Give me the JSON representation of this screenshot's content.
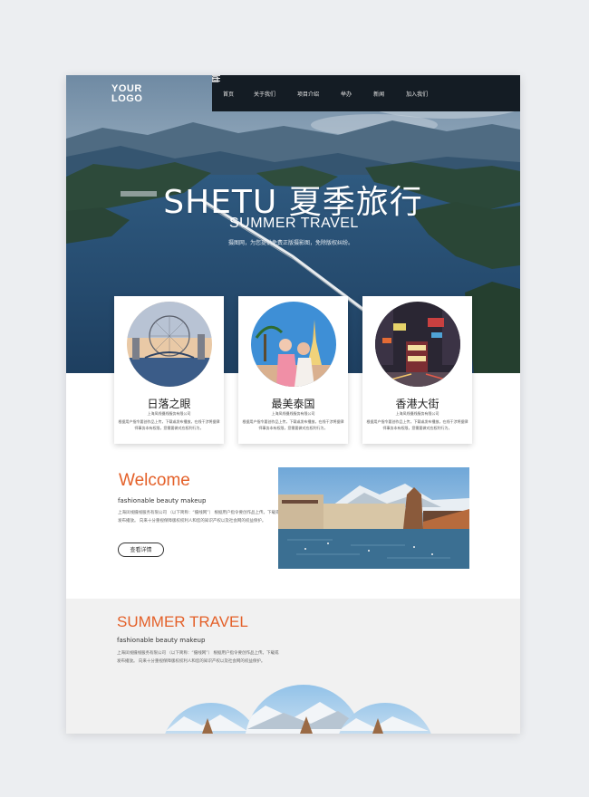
{
  "logo": {
    "line1": "YOUR",
    "line2": "LOGO"
  },
  "nav": {
    "items": [
      "首页",
      "关于我们",
      "项目介绍",
      "举办",
      "新闻",
      "加入我们"
    ],
    "icons": [
      "bag-icon",
      "search-icon",
      "menu-icon"
    ]
  },
  "hero": {
    "title": "SHETU 夏季旅行",
    "subtitle": "SUMMER TRAVEL",
    "desc": "摄图网，为您提供免费正版摄影图，免除版权纠纷。"
  },
  "cards": [
    {
      "title": "日落之眼",
      "line1": "上海凤线摄线服务有限公司",
      "line2": "根据用户指令要创作品上传，下载或发布播放，在线干涉将据律师事务本有权限，您需要做对应权利行为，"
    },
    {
      "title": "最美泰国",
      "line1": "上海凤线摄线服务有限公司",
      "line2": "根据用户指令要创作品上传，下载或发布播放，在线干涉将据律师事务本有权限，您需要做对应权利行为，"
    },
    {
      "title": "香港大街",
      "line1": "上海凤线摄线服务有限公司",
      "line2": "根据用户指令要创作品上传，下载或发布播放，在线干涉将据律师事务本有权限，您需要做对应权利行为，"
    }
  ],
  "welcome": {
    "title": "Welcome",
    "subtitle": "fashionable beauty makeup",
    "text": "上海凤线摄线服务有限公司 （以下简称：“摄线网”） 根据用户指令要创作品上传。下载或发布播放。 向来十分重视保障版权权利人和您的知识产权以及社会网的权益保护。",
    "button": "查看详情"
  },
  "summer": {
    "title": "SUMMER TRAVEL",
    "subtitle": "fashionable beauty makeup",
    "text": "上海凤线摄线服务有限公司 （以下简称：“摄线网”） 根据用户指令要创作品上传。下载或发布播放。 向来十分重视保障版权权利人和您的知识产权以及社会网的权益保护。"
  },
  "colors": {
    "accent": "#e4612a",
    "nav_bg": "#141c24",
    "page_bg": "#eceef1"
  }
}
